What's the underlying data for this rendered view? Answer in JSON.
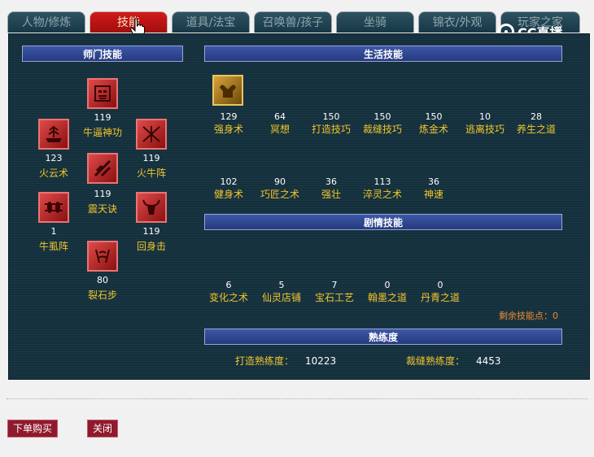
{
  "tabs": [
    {
      "label": "人物/修炼"
    },
    {
      "label": "技能"
    },
    {
      "label": "道具/法宝"
    },
    {
      "label": "召唤兽/孩子"
    },
    {
      "label": "坐骑"
    },
    {
      "label": "锦衣/外观"
    },
    {
      "label": "玩家之家"
    }
  ],
  "watermark": "CC直播",
  "sections": {
    "master": "师门技能",
    "life": "生活技能",
    "plot": "剧情技能",
    "proficiency": "熟练度"
  },
  "master_skills": [
    {
      "value": "119",
      "name": "牛逼神功",
      "icon": "demon-mask-icon"
    },
    {
      "value": "123",
      "name": "火云术",
      "icon": "cloud-ship-icon"
    },
    {
      "value": "119",
      "name": "火牛阵",
      "icon": "fire-bull-icon"
    },
    {
      "value": "119",
      "name": "震天诀",
      "icon": "slash-icon"
    },
    {
      "value": "1",
      "name": "牛虱阵",
      "icon": "lice-array-icon"
    },
    {
      "value": "119",
      "name": "回身击",
      "icon": "bull-head-icon"
    },
    {
      "value": "80",
      "name": "裂石步",
      "icon": "split-rock-icon"
    }
  ],
  "life_icon": "strength-icon",
  "life_skills": [
    {
      "value": "129",
      "name": "强身术"
    },
    {
      "value": "64",
      "name": "冥想"
    },
    {
      "value": "150",
      "name": "打造技巧"
    },
    {
      "value": "150",
      "name": "裁缝技巧"
    },
    {
      "value": "150",
      "name": "炼金术"
    },
    {
      "value": "10",
      "name": "逃离技巧"
    },
    {
      "value": "28",
      "name": "养生之道"
    },
    {
      "value": "102",
      "name": "健身术"
    },
    {
      "value": "90",
      "name": "巧匠之术"
    },
    {
      "value": "36",
      "name": "强壮"
    },
    {
      "value": "113",
      "name": "淬灵之术"
    },
    {
      "value": "36",
      "name": "神速"
    }
  ],
  "plot_skills": [
    {
      "value": "6",
      "name": "变化之术"
    },
    {
      "value": "5",
      "name": "仙灵店铺"
    },
    {
      "value": "7",
      "name": "宝石工艺"
    },
    {
      "value": "0",
      "name": "翰墨之道"
    },
    {
      "value": "0",
      "name": "丹青之道"
    }
  ],
  "remaining_points": "剩余技能点：0",
  "proficiency": [
    {
      "label": "打造熟练度：",
      "value": "10223"
    },
    {
      "label": "裁缝熟练度：",
      "value": "4453"
    }
  ],
  "buttons": {
    "buy": "下单购买",
    "close": "关闭"
  },
  "colors": {
    "active_tab": "#c41414",
    "panel": "#14303d",
    "label": "#f2c62b",
    "remain": "#f28b30",
    "button": "#8e1a2e"
  }
}
